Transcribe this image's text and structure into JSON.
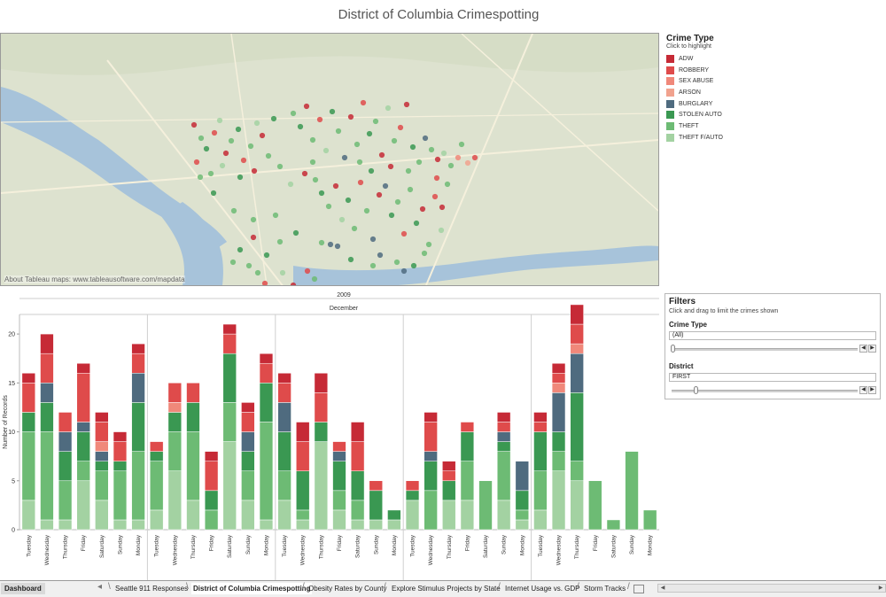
{
  "page": {
    "title": "District of Columbia Crimespotting"
  },
  "map": {
    "attribution": "About Tableau maps: www.tableausoftware.com/mapdata",
    "points": [
      {
        "lon": 218,
        "lat": 103,
        "t": "ADW"
      },
      {
        "lon": 226,
        "lat": 118,
        "t": "THEFT"
      },
      {
        "lon": 232,
        "lat": 130,
        "t": "STOLEN AUTO"
      },
      {
        "lon": 241,
        "lat": 112,
        "t": "ROBBERY"
      },
      {
        "lon": 247,
        "lat": 98,
        "t": "THEFT F/AUTO"
      },
      {
        "lon": 254,
        "lat": 135,
        "t": "ADW"
      },
      {
        "lon": 260,
        "lat": 121,
        "t": "THEFT"
      },
      {
        "lon": 268,
        "lat": 108,
        "t": "STOLEN AUTO"
      },
      {
        "lon": 274,
        "lat": 143,
        "t": "ROBBERY"
      },
      {
        "lon": 282,
        "lat": 127,
        "t": "THEFT"
      },
      {
        "lon": 289,
        "lat": 101,
        "t": "THEFT F/AUTO"
      },
      {
        "lon": 295,
        "lat": 115,
        "t": "ADW"
      },
      {
        "lon": 302,
        "lat": 138,
        "t": "THEFT"
      },
      {
        "lon": 308,
        "lat": 96,
        "t": "STOLEN AUTO"
      },
      {
        "lon": 315,
        "lat": 150,
        "t": "THEFT"
      },
      {
        "lon": 221,
        "lat": 145,
        "t": "ROBBERY"
      },
      {
        "lon": 237,
        "lat": 158,
        "t": "THEFT"
      },
      {
        "lon": 250,
        "lat": 149,
        "t": "THEFT F/AUTO"
      },
      {
        "lon": 270,
        "lat": 162,
        "t": "STOLEN AUTO"
      },
      {
        "lon": 286,
        "lat": 155,
        "t": "ADW"
      },
      {
        "lon": 330,
        "lat": 90,
        "t": "THEFT"
      },
      {
        "lon": 338,
        "lat": 105,
        "t": "STOLEN AUTO"
      },
      {
        "lon": 345,
        "lat": 82,
        "t": "ADW"
      },
      {
        "lon": 352,
        "lat": 120,
        "t": "THEFT"
      },
      {
        "lon": 360,
        "lat": 97,
        "t": "ROBBERY"
      },
      {
        "lon": 367,
        "lat": 132,
        "t": "THEFT F/AUTO"
      },
      {
        "lon": 374,
        "lat": 88,
        "t": "STOLEN AUTO"
      },
      {
        "lon": 381,
        "lat": 110,
        "t": "THEFT"
      },
      {
        "lon": 388,
        "lat": 140,
        "t": "BURGLARY"
      },
      {
        "lon": 395,
        "lat": 94,
        "t": "ADW"
      },
      {
        "lon": 402,
        "lat": 125,
        "t": "THEFT"
      },
      {
        "lon": 409,
        "lat": 78,
        "t": "ROBBERY"
      },
      {
        "lon": 416,
        "lat": 113,
        "t": "STOLEN AUTO"
      },
      {
        "lon": 423,
        "lat": 99,
        "t": "THEFT"
      },
      {
        "lon": 430,
        "lat": 137,
        "t": "ADW"
      },
      {
        "lon": 437,
        "lat": 84,
        "t": "THEFT F/AUTO"
      },
      {
        "lon": 444,
        "lat": 121,
        "t": "THEFT"
      },
      {
        "lon": 451,
        "lat": 106,
        "t": "ROBBERY"
      },
      {
        "lon": 458,
        "lat": 80,
        "t": "ADW"
      },
      {
        "lon": 465,
        "lat": 128,
        "t": "STOLEN AUTO"
      },
      {
        "lon": 472,
        "lat": 145,
        "t": "THEFT"
      },
      {
        "lon": 479,
        "lat": 118,
        "t": "BURGLARY"
      },
      {
        "lon": 486,
        "lat": 131,
        "t": "THEFT"
      },
      {
        "lon": 493,
        "lat": 142,
        "t": "ADW"
      },
      {
        "lon": 500,
        "lat": 135,
        "t": "THEFT F/AUTO"
      },
      {
        "lon": 508,
        "lat": 149,
        "t": "THEFT"
      },
      {
        "lon": 516,
        "lat": 140,
        "t": "SEX ABUSE"
      },
      {
        "lon": 527,
        "lat": 146,
        "t": "ARSON"
      },
      {
        "lon": 535,
        "lat": 140,
        "t": "ROBBERY"
      },
      {
        "lon": 520,
        "lat": 125,
        "t": "THEFT"
      },
      {
        "lon": 355,
        "lat": 165,
        "t": "THEFT"
      },
      {
        "lon": 362,
        "lat": 180,
        "t": "STOLEN AUTO"
      },
      {
        "lon": 370,
        "lat": 195,
        "t": "THEFT"
      },
      {
        "lon": 378,
        "lat": 172,
        "t": "ADW"
      },
      {
        "lon": 385,
        "lat": 210,
        "t": "THEFT F/AUTO"
      },
      {
        "lon": 392,
        "lat": 188,
        "t": "STOLEN AUTO"
      },
      {
        "lon": 399,
        "lat": 220,
        "t": "THEFT"
      },
      {
        "lon": 406,
        "lat": 168,
        "t": "ROBBERY"
      },
      {
        "lon": 413,
        "lat": 200,
        "t": "THEFT"
      },
      {
        "lon": 420,
        "lat": 232,
        "t": "BURGLARY"
      },
      {
        "lon": 427,
        "lat": 182,
        "t": "ADW"
      },
      {
        "lon": 434,
        "lat": 172,
        "t": "BURGLARY"
      },
      {
        "lon": 441,
        "lat": 205,
        "t": "STOLEN AUTO"
      },
      {
        "lon": 448,
        "lat": 190,
        "t": "THEFT"
      },
      {
        "lon": 455,
        "lat": 226,
        "t": "ROBBERY"
      },
      {
        "lon": 462,
        "lat": 176,
        "t": "THEFT"
      },
      {
        "lon": 469,
        "lat": 214,
        "t": "STOLEN AUTO"
      },
      {
        "lon": 476,
        "lat": 198,
        "t": "ADW"
      },
      {
        "lon": 483,
        "lat": 238,
        "t": "THEFT"
      },
      {
        "lon": 490,
        "lat": 184,
        "t": "ROBBERY"
      },
      {
        "lon": 497,
        "lat": 222,
        "t": "THEFT F/AUTO"
      },
      {
        "lon": 504,
        "lat": 170,
        "t": "THEFT"
      },
      {
        "lon": 380,
        "lat": 240,
        "t": "BURGLARY"
      },
      {
        "lon": 428,
        "lat": 250,
        "t": "BURGLARY"
      },
      {
        "lon": 447,
        "lat": 258,
        "t": "THEFT"
      },
      {
        "lon": 455,
        "lat": 268,
        "t": "BURGLARY"
      },
      {
        "lon": 466,
        "lat": 262,
        "t": "STOLEN AUTO"
      },
      {
        "lon": 478,
        "lat": 248,
        "t": "THEFT"
      },
      {
        "lon": 372,
        "lat": 238,
        "t": "BURGLARY"
      },
      {
        "lon": 362,
        "lat": 236,
        "t": "THEFT"
      },
      {
        "lon": 262,
        "lat": 258,
        "t": "THEFT"
      },
      {
        "lon": 270,
        "lat": 244,
        "t": "STOLEN AUTO"
      },
      {
        "lon": 280,
        "lat": 262,
        "t": "THEFT"
      },
      {
        "lon": 290,
        "lat": 270,
        "t": "THEFT"
      },
      {
        "lon": 298,
        "lat": 282,
        "t": "ROBBERY"
      },
      {
        "lon": 306,
        "lat": 296,
        "t": "THEFT"
      },
      {
        "lon": 314,
        "lat": 288,
        "t": "STOLEN AUTO"
      },
      {
        "lon": 322,
        "lat": 298,
        "t": "THEFT"
      },
      {
        "lon": 330,
        "lat": 284,
        "t": "ADW"
      },
      {
        "lon": 318,
        "lat": 270,
        "t": "THEFT F/AUTO"
      },
      {
        "lon": 346,
        "lat": 268,
        "t": "ROBBERY"
      },
      {
        "lon": 354,
        "lat": 277,
        "t": "THEFT"
      },
      {
        "lon": 300,
        "lat": 250,
        "t": "STOLEN AUTO"
      },
      {
        "lon": 285,
        "lat": 230,
        "t": "ADW"
      },
      {
        "lon": 263,
        "lat": 200,
        "t": "THEFT"
      },
      {
        "lon": 285,
        "lat": 210,
        "t": "THEFT"
      },
      {
        "lon": 310,
        "lat": 205,
        "t": "THEFT"
      },
      {
        "lon": 333,
        "lat": 225,
        "t": "STOLEN AUTO"
      },
      {
        "lon": 315,
        "lat": 235,
        "t": "THEFT"
      },
      {
        "lon": 240,
        "lat": 180,
        "t": "STOLEN AUTO"
      },
      {
        "lon": 225,
        "lat": 162,
        "t": "THEFT"
      },
      {
        "lon": 352,
        "lat": 145,
        "t": "THEFT"
      },
      {
        "lon": 343,
        "lat": 158,
        "t": "ADW"
      },
      {
        "lon": 327,
        "lat": 170,
        "t": "THEFT F/AUTO"
      },
      {
        "lon": 405,
        "lat": 145,
        "t": "THEFT"
      },
      {
        "lon": 418,
        "lat": 155,
        "t": "STOLEN AUTO"
      },
      {
        "lon": 440,
        "lat": 150,
        "t": "ADW"
      },
      {
        "lon": 460,
        "lat": 155,
        "t": "THEFT"
      },
      {
        "lon": 492,
        "lat": 163,
        "t": "ROBBERY"
      },
      {
        "lon": 498,
        "lat": 196,
        "t": "ADW"
      },
      {
        "lon": 420,
        "lat": 262,
        "t": "THEFT"
      },
      {
        "lon": 395,
        "lat": 255,
        "t": "STOLEN AUTO"
      }
    ]
  },
  "legend": {
    "title": "Crime Type",
    "subtitle": "Click to highlight",
    "items": [
      {
        "label": "ADW",
        "color": "#c62a36"
      },
      {
        "label": "ROBBERY",
        "color": "#df4b4b"
      },
      {
        "label": "SEX ABUSE",
        "color": "#f0887a"
      },
      {
        "label": "ARSON",
        "color": "#f1a28e"
      },
      {
        "label": "BURGLARY",
        "color": "#4f6b7f"
      },
      {
        "label": "STOLEN AUTO",
        "color": "#3a9852"
      },
      {
        "label": "THEFT",
        "color": "#6dbb74"
      },
      {
        "label": "THEFT F/AUTO",
        "color": "#a3d2a2"
      }
    ]
  },
  "filters": {
    "title": "Filters",
    "subtitle": "Click and drag to limit the crimes shown",
    "crime_type": {
      "label": "Crime Type",
      "value": "(All)"
    },
    "district": {
      "label": "District",
      "value": "FIRST"
    }
  },
  "chart_data": {
    "type": "bar",
    "stacked": true,
    "header_top": "2009",
    "header_month": "December",
    "ylabel": "Number of Records",
    "ylim": [
      0,
      22
    ],
    "yticks": [
      0,
      5,
      10,
      15,
      20
    ],
    "series_order": [
      "THEFT F/AUTO",
      "THEFT",
      "STOLEN AUTO",
      "BURGLARY",
      "ARSON",
      "SEX ABUSE",
      "ROBBERY",
      "ADW"
    ],
    "group_sizes": [
      7,
      7,
      7,
      7,
      2
    ],
    "categories": [
      "Tuesday",
      "Wednesday",
      "Thursday",
      "Friday",
      "Saturday",
      "Sunday",
      "Monday",
      "Tuesday",
      "Wednesday",
      "Thursday",
      "Friday",
      "Saturday",
      "Sunday",
      "Monday",
      "Tuesday",
      "Wednesday",
      "Thursday",
      "Friday",
      "Saturday",
      "Sunday",
      "Monday",
      "Tuesday",
      "Wednesday",
      "Thursday",
      "Friday",
      "Saturday",
      "Sunday",
      "Monday",
      "Tuesday",
      "Wednesday",
      "Thursday",
      "Friday",
      "Saturday",
      "Sunday",
      "Monday"
    ],
    "series": [
      {
        "name": "THEFT F/AUTO",
        "values": [
          3,
          1,
          1,
          5,
          3,
          1,
          1,
          2,
          6,
          3,
          0,
          9,
          3,
          1,
          3,
          1,
          9,
          2,
          1,
          1,
          1,
          3,
          0,
          3,
          3,
          0,
          3,
          1,
          2,
          6,
          5
        ]
      },
      {
        "name": "THEFT",
        "values": [
          7,
          9,
          4,
          2,
          3,
          5,
          7,
          5,
          4,
          7,
          2,
          4,
          3,
          10,
          3,
          1,
          0,
          2,
          2,
          0,
          0,
          0,
          4,
          0,
          4,
          5,
          5,
          1,
          4,
          2,
          2,
          5,
          1,
          8,
          2,
          1
        ]
      },
      {
        "name": "STOLEN AUTO",
        "values": [
          2,
          3,
          3,
          3,
          1,
          1,
          5,
          1,
          2,
          3,
          2,
          5,
          2,
          4,
          4,
          4,
          2,
          3,
          3,
          3,
          1,
          1,
          3,
          2,
          3,
          0,
          1,
          2,
          4,
          2,
          7
        ]
      },
      {
        "name": "BURGLARY",
        "values": [
          0,
          2,
          2,
          1,
          1,
          0,
          3,
          0,
          0,
          0,
          0,
          0,
          2,
          0,
          3,
          0,
          0,
          1,
          0,
          0,
          0,
          0,
          1,
          0,
          0,
          0,
          1,
          3,
          0,
          4,
          4
        ]
      },
      {
        "name": "ARSON",
        "values": [
          0,
          0,
          0,
          0,
          0,
          0,
          0,
          0,
          0,
          0,
          0,
          0,
          0,
          0,
          0,
          0,
          0,
          0,
          0,
          0,
          0,
          0,
          0,
          0,
          0,
          0,
          0,
          0,
          0,
          0,
          0
        ]
      },
      {
        "name": "SEX ABUSE",
        "values": [
          0,
          0,
          0,
          0,
          1,
          0,
          0,
          0,
          1,
          0,
          0,
          0,
          0,
          0,
          0,
          0,
          0,
          0,
          0,
          0,
          0,
          0,
          0,
          0,
          0,
          0,
          0,
          0,
          0,
          1,
          1
        ]
      },
      {
        "name": "ROBBERY",
        "values": [
          3,
          3,
          2,
          5,
          2,
          2,
          2,
          1,
          2,
          2,
          3,
          2,
          2,
          2,
          2,
          3,
          3,
          1,
          3,
          1,
          0,
          1,
          3,
          1,
          1,
          0,
          1,
          0,
          1,
          1,
          2
        ]
      },
      {
        "name": "ADW",
        "values": [
          1,
          2,
          0,
          1,
          1,
          1,
          1,
          0,
          0,
          0,
          1,
          1,
          1,
          1,
          1,
          2,
          2,
          0,
          2,
          0,
          0,
          0,
          1,
          1,
          0,
          0,
          1,
          0,
          1,
          1,
          2
        ]
      }
    ]
  },
  "tabs": [
    {
      "label": "Dashboard"
    },
    {
      "label": "Seattle 911 Responses"
    },
    {
      "label": "District of Columbia Crimespotting"
    },
    {
      "label": "Obesity Rates by County"
    },
    {
      "label": "Explore Stimulus Projects by State"
    },
    {
      "label": "Internet Usage vs. GDP"
    },
    {
      "label": "Storm Tracks"
    }
  ]
}
